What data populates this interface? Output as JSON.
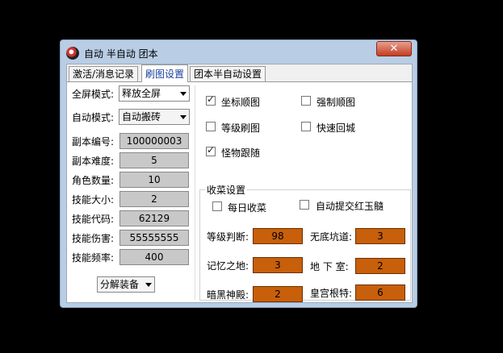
{
  "window": {
    "title": "自动 半自动 团本",
    "close_label": "✕"
  },
  "tabs": [
    {
      "label": "激活/消息记录"
    },
    {
      "label": "刷图设置"
    },
    {
      "label": "团本半自动设置"
    }
  ],
  "left": {
    "fullscreen_mode_label": "全屏模式:",
    "fullscreen_mode_value": "释放全屏",
    "auto_mode_label": "自动模式:",
    "auto_mode_value": "自动搬砖",
    "fields": [
      {
        "label": "副本编号:",
        "value": "100000003"
      },
      {
        "label": "副本难度:",
        "value": "5"
      },
      {
        "label": "角色数量:",
        "value": "10"
      },
      {
        "label": "技能大小:",
        "value": "2"
      },
      {
        "label": "技能代码:",
        "value": "62129"
      },
      {
        "label": "技能伤害:",
        "value": "55555555"
      },
      {
        "label": "技能频率:",
        "value": "400"
      }
    ],
    "decompose_value": "分解装备"
  },
  "options": [
    {
      "label": "坐标顺图",
      "checked": true
    },
    {
      "label": "强制顺图",
      "checked": false
    },
    {
      "label": "等级刷图",
      "checked": false
    },
    {
      "label": "快速回城",
      "checked": false
    },
    {
      "label": "怪物跟随",
      "checked": true
    }
  ],
  "collect": {
    "title": "收菜设置",
    "daily_label": "每日收菜",
    "daily_checked": false,
    "auto_submit_label": "自动提交红玉髓",
    "auto_submit_checked": false,
    "fields": [
      {
        "label": "等级判断:",
        "value": "98"
      },
      {
        "label": "无底坑道:",
        "value": "3"
      },
      {
        "label": "记忆之地:",
        "value": "3"
      },
      {
        "label": "地 下 室:",
        "value": "2"
      },
      {
        "label": "暗黑神殿:",
        "value": "2"
      },
      {
        "label": "皇宫根特:",
        "value": "6"
      }
    ]
  }
}
